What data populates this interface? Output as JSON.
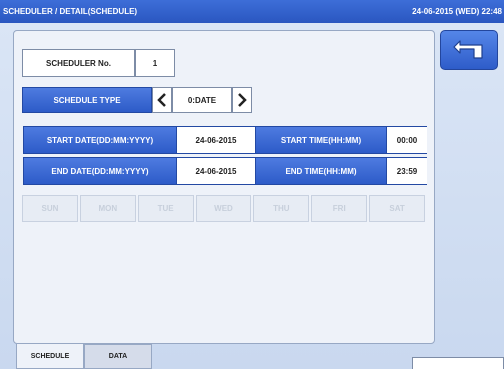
{
  "titlebar": {
    "title": "SCHEDULER / DETAIL(SCHEDULE)",
    "datetime": "24-06-2015 (WED) 22:48"
  },
  "scheduler": {
    "number_label": "SCHEDULER No.",
    "number_value": "1"
  },
  "schedule_type": {
    "label": "SCHEDULE TYPE",
    "value": "0:DATE"
  },
  "start": {
    "date_label": "START DATE(DD:MM:YYYY)",
    "date_value": "24-06-2015",
    "time_label": "START TIME(HH:MM)",
    "time_value": "00:00"
  },
  "end": {
    "date_label": "END DATE(DD:MM:YYYY)",
    "date_value": "24-06-2015",
    "time_label": "END TIME(HH:MM)",
    "time_value": "23:59"
  },
  "days": [
    "SUN",
    "MON",
    "TUE",
    "WED",
    "THU",
    "FRI",
    "SAT"
  ],
  "tabs": {
    "schedule": "SCHEDULE",
    "data": "DATA"
  },
  "icons": {
    "back": "return-arrow-icon",
    "prev": "chevron-left-icon",
    "next": "chevron-right-icon"
  },
  "colors": {
    "accent": "#2d5bc8",
    "titlebar": "#3d6ed8",
    "disabled_text": "#c7cfdb"
  }
}
